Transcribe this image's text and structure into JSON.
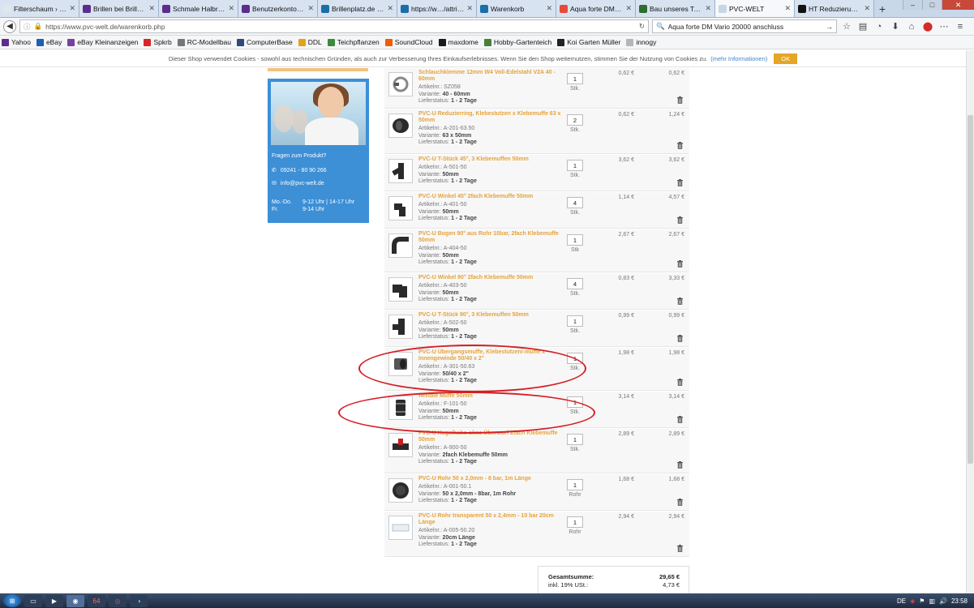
{
  "browser": {
    "tabs": [
      {
        "title": "Filterschaum › S…",
        "color": "#dfe6ee"
      },
      {
        "title": "Brillen bei Brille2…",
        "color": "#5b2d8e"
      },
      {
        "title": "Schmale Halbra…",
        "color": "#5b2d8e"
      },
      {
        "title": "Benutzerkonto a…",
        "color": "#5b2d8e"
      },
      {
        "title": "Brillenplatz.de – …",
        "color": "#1a6fa8"
      },
      {
        "title": "https://w…/attribs",
        "color": "#1a6fa8"
      },
      {
        "title": "Warenkorb",
        "color": "#1a6fa8"
      },
      {
        "title": "Aqua forte DM V…",
        "color": "#e84a3a"
      },
      {
        "title": "Bau unseres Teic…",
        "color": "#2f6e2f"
      },
      {
        "title": "PVC-WELT",
        "color": "#c8d5e6",
        "active": true
      },
      {
        "title": "HT Reduzierung …",
        "color": "#111111"
      }
    ],
    "url": "https://www.pvc-welt.de/warenkorb.php",
    "search_value": "Aqua forte DM Vario 20000 anschluss",
    "bookmarks": [
      {
        "label": "Yahoo",
        "color": "#5f2b91"
      },
      {
        "label": "eBay",
        "color": "#1d5fb2"
      },
      {
        "label": "eBay Kleinanzeigen",
        "color": "#7b3fa0"
      },
      {
        "label": "Spkrb",
        "color": "#d7262a"
      },
      {
        "label": "RC-Modellbau",
        "color": "#777777"
      },
      {
        "label": "ComputerBase",
        "color": "#2c4a7a"
      },
      {
        "label": "DDL",
        "color": "#e5a11a"
      },
      {
        "label": "Teichpflanzen",
        "color": "#3d8a3d"
      },
      {
        "label": "SoundCloud",
        "color": "#f45a00"
      },
      {
        "label": "maxdome",
        "color": "#1a1a1a"
      },
      {
        "label": "Hobby-Gartenteich",
        "color": "#4a7f3a"
      },
      {
        "label": "Koi Garten Müller",
        "color": "#222222"
      },
      {
        "label": "innogy",
        "color": "#b6b6b6"
      }
    ]
  },
  "cookie_banner": {
    "text": "Dieser Shop verwendet Cookies - sowohl aus technischen Gründen, als auch zur Verbesserung Ihres Einkaufserlebnisses. Wenn Sie den Shop weiternutzen, stimmen Sie der Nutzung von Cookies zu.",
    "link": "(mehr Informationen)",
    "ok": "OK"
  },
  "contact": {
    "question": "Fragen zum Produkt?",
    "phone": "09241 - 80 90 266",
    "email": "info@pvc-welt.de",
    "hours": [
      {
        "days": "Mo.-Do.",
        "time": "9-12 Uhr | 14-17 Uhr"
      },
      {
        "days": "Fr.",
        "time": "9-14 Uhr"
      }
    ]
  },
  "cart": {
    "labels": {
      "article_no": "Artikelnr.:",
      "variant": "Variante:",
      "delivery": "Lieferstatus:"
    },
    "items": [
      {
        "name": "Schlauchklemme 12mm W4 Voll-Edelstahl V2A 40 - 60mm",
        "article": "SZ058",
        "variant": "40 - 60mm",
        "delivery": "1 - 2 Tage",
        "qty": "1",
        "unit": "Stk.",
        "price": "0,62 €",
        "total": "0,62 €"
      },
      {
        "name": "PVC-U Reduzierring, Klebestutzen x Klebemuffe 63 x 50mm",
        "article": "A-201-63.50",
        "variant": "63 x 50mm",
        "delivery": "1 - 2 Tage",
        "qty": "2",
        "unit": "Stk.",
        "price": "0,62 €",
        "total": "1,24 €"
      },
      {
        "name": "PVC-U T-Stück 45°, 3 Klebemuffen 50mm",
        "article": "A-501-50",
        "variant": "50mm",
        "delivery": "1 - 2 Tage",
        "qty": "1",
        "unit": "Stk.",
        "price": "3,62 €",
        "total": "3,62 €"
      },
      {
        "name": "PVC-U Winkel 45° 2fach Klebemuffe 50mm",
        "article": "A-401-50",
        "variant": "50mm",
        "delivery": "1 - 2 Tage",
        "qty": "4",
        "unit": "Stk.",
        "price": "1,14 €",
        "total": "4,57 €"
      },
      {
        "name": "PVC-U Bogen 90° aus Rohr 10bar, 2fach Klebemuffe 50mm",
        "article": "A-404-50",
        "variant": "50mm",
        "delivery": "1 - 2 Tage",
        "qty": "1",
        "unit": "Stk",
        "price": "2,67 €",
        "total": "2,67 €"
      },
      {
        "name": "PVC-U Winkel 90° 2fach Klebemuffe 50mm",
        "article": "A-403-50",
        "variant": "50mm",
        "delivery": "1 - 2 Tage",
        "qty": "4",
        "unit": "Stk.",
        "price": "0,83 €",
        "total": "3,33 €"
      },
      {
        "name": "PVC-U T-Stück 90°, 3 Klebemuffen 50mm",
        "article": "A-502-50",
        "variant": "50mm",
        "delivery": "1 - 2 Tage",
        "qty": "1",
        "unit": "Stk.",
        "price": "0,99 €",
        "total": "0,99 €"
      },
      {
        "name": "PVC-U Übergangsmuffe, Klebestutzen/-muffe x Innengewinde 50/40 x 2\"",
        "article": "A-301-50.63",
        "variant": "50/40 x 2\"",
        "delivery": "1 - 2 Tage",
        "qty": "1",
        "unit": "Stk.",
        "price": "1,98 €",
        "total": "1,98 €"
      },
      {
        "name": "flexible Muffe 50mm",
        "article": "F-101-50",
        "variant": "50mm",
        "delivery": "1 - 2 Tage",
        "qty": "1",
        "unit": "Stk.",
        "price": "3,14 €",
        "total": "3,14 €"
      },
      {
        "name": "PVC-U Kugelhahn ohne Überwurf 2fach Klebemuffe 50mm",
        "article": "A-900-50",
        "variant": "2fach Klebemuffe 50mm",
        "delivery": "1 - 2 Tage",
        "qty": "1",
        "unit": "Stk.",
        "price": "2,89 €",
        "total": "2,89 €"
      },
      {
        "name": "PVC-U Rohr 50 x 2,0mm - 8 bar, 1m Länge",
        "article": "A-001-50.1",
        "variant": "50 x 2,0mm - 8bar, 1m Rohr",
        "delivery": "1 - 2 Tage",
        "qty": "1",
        "unit": "Rohr",
        "price": "1,68 €",
        "total": "1,68 €"
      },
      {
        "name": "PVC-U Rohr transparent 50 x 2,4mm - 10 bar 20cm Länge",
        "article": "A-005-50.20",
        "variant": "20cm Länge",
        "delivery": "1 - 2 Tage",
        "qty": "1",
        "unit": "Rohr",
        "price": "2,94 €",
        "total": "2,94 €"
      }
    ],
    "summary": {
      "total_label": "Gesamtsumme:",
      "total_value": "29,65 €",
      "vat_label": "inkl. 19% USt.:",
      "vat_value": "4,73 €"
    }
  },
  "taskbar": {
    "lang": "DE",
    "time": "23:58"
  }
}
